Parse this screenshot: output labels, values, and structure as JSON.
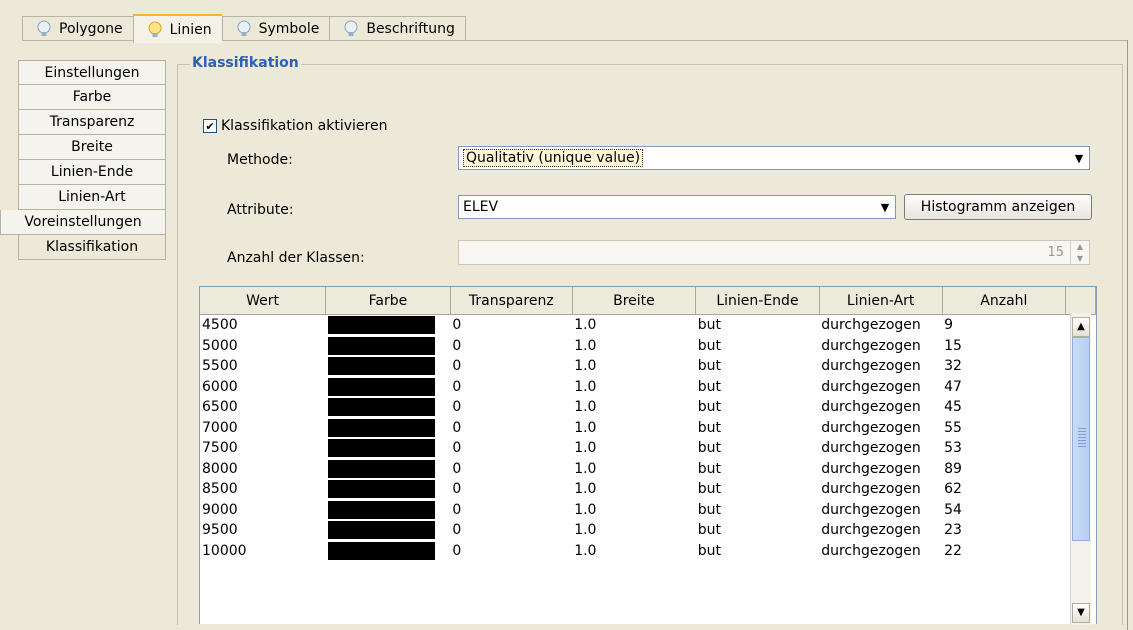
{
  "top_tabs": [
    {
      "label": "Polygone",
      "icon": "lightbulb-icon",
      "active": false
    },
    {
      "label": "Linien",
      "icon": "lightbulb-icon",
      "active": true
    },
    {
      "label": "Symbole",
      "icon": "lightbulb-icon",
      "active": false
    },
    {
      "label": "Beschriftung",
      "icon": "lightbulb-icon",
      "active": false
    }
  ],
  "side_tabs": [
    {
      "label": "Einstellungen"
    },
    {
      "label": "Farbe"
    },
    {
      "label": "Transparenz"
    },
    {
      "label": "Breite"
    },
    {
      "label": "Linien-Ende"
    },
    {
      "label": "Linien-Art"
    },
    {
      "label": "Voreinstellungen"
    },
    {
      "label": "Klassifikation"
    }
  ],
  "classification": {
    "group_title": "Klassifikation",
    "enable_label": "Klassifikation aktivieren",
    "enabled": true,
    "method_label": "Methode:",
    "method_value": "Qualitativ (unique value)",
    "attribute_label": "Attribute:",
    "attribute_value": "ELEV",
    "histogram_button": "Histogramm anzeigen",
    "classes_label": "Anzahl der Klassen:",
    "classes_value": "15"
  },
  "table": {
    "columns": [
      "Wert",
      "Farbe",
      "Transparenz",
      "Breite",
      "Linien-Ende",
      "Linien-Art",
      "Anzahl"
    ],
    "rows": [
      {
        "wert": "4500",
        "farbe": "#000000",
        "transparenz": "0",
        "breite": "1.0",
        "ende": "but",
        "art": "durchgezogen",
        "anzahl": "9"
      },
      {
        "wert": "5000",
        "farbe": "#000000",
        "transparenz": "0",
        "breite": "1.0",
        "ende": "but",
        "art": "durchgezogen",
        "anzahl": "15"
      },
      {
        "wert": "5500",
        "farbe": "#000000",
        "transparenz": "0",
        "breite": "1.0",
        "ende": "but",
        "art": "durchgezogen",
        "anzahl": "32"
      },
      {
        "wert": "6000",
        "farbe": "#000000",
        "transparenz": "0",
        "breite": "1.0",
        "ende": "but",
        "art": "durchgezogen",
        "anzahl": "47"
      },
      {
        "wert": "6500",
        "farbe": "#000000",
        "transparenz": "0",
        "breite": "1.0",
        "ende": "but",
        "art": "durchgezogen",
        "anzahl": "45"
      },
      {
        "wert": "7000",
        "farbe": "#000000",
        "transparenz": "0",
        "breite": "1.0",
        "ende": "but",
        "art": "durchgezogen",
        "anzahl": "55"
      },
      {
        "wert": "7500",
        "farbe": "#000000",
        "transparenz": "0",
        "breite": "1.0",
        "ende": "but",
        "art": "durchgezogen",
        "anzahl": "53"
      },
      {
        "wert": "8000",
        "farbe": "#000000",
        "transparenz": "0",
        "breite": "1.0",
        "ende": "but",
        "art": "durchgezogen",
        "anzahl": "89"
      },
      {
        "wert": "8500",
        "farbe": "#000000",
        "transparenz": "0",
        "breite": "1.0",
        "ende": "but",
        "art": "durchgezogen",
        "anzahl": "62"
      },
      {
        "wert": "9000",
        "farbe": "#000000",
        "transparenz": "0",
        "breite": "1.0",
        "ende": "but",
        "art": "durchgezogen",
        "anzahl": "54"
      },
      {
        "wert": "9500",
        "farbe": "#000000",
        "transparenz": "0",
        "breite": "1.0",
        "ende": "but",
        "art": "durchgezogen",
        "anzahl": "23"
      },
      {
        "wert": "10000",
        "farbe": "#000000",
        "transparenz": "0",
        "breite": "1.0",
        "ende": "but",
        "art": "durchgezogen",
        "anzahl": "22"
      }
    ]
  },
  "colors": {
    "group_title": "#2d5fb8",
    "active_tab_accent": "#f9b434",
    "window_bg": "#ece9d8"
  }
}
